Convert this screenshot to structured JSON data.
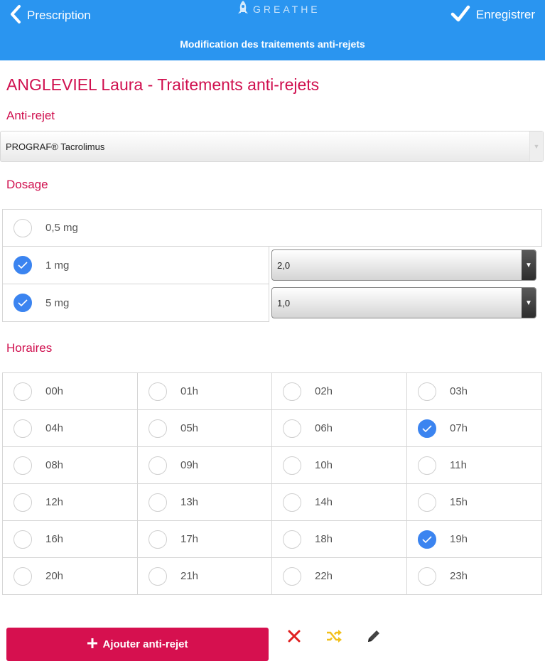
{
  "header": {
    "back_label": "Prescription",
    "logo_text": "GREATHE",
    "save_label": "Enregistrer",
    "subtitle": "Modification des traitements anti-rejets"
  },
  "page_title": "ANGLEVIEL Laura - Traitements anti-rejets",
  "antirejet": {
    "title": "Anti-rejet",
    "selected": "PROGRAF® Tacrolimus"
  },
  "dosage": {
    "title": "Dosage",
    "options": [
      {
        "label": "0,5 mg",
        "checked": false
      },
      {
        "label": "1 mg",
        "checked": true,
        "quantity": "2,0"
      },
      {
        "label": "5 mg",
        "checked": true,
        "quantity": "1,0"
      }
    ]
  },
  "horaires": {
    "title": "Horaires",
    "hours": [
      {
        "label": "00h",
        "checked": false
      },
      {
        "label": "01h",
        "checked": false
      },
      {
        "label": "02h",
        "checked": false
      },
      {
        "label": "03h",
        "checked": false
      },
      {
        "label": "04h",
        "checked": false
      },
      {
        "label": "05h",
        "checked": false
      },
      {
        "label": "06h",
        "checked": false
      },
      {
        "label": "07h",
        "checked": true
      },
      {
        "label": "08h",
        "checked": false
      },
      {
        "label": "09h",
        "checked": false
      },
      {
        "label": "10h",
        "checked": false
      },
      {
        "label": "11h",
        "checked": false
      },
      {
        "label": "12h",
        "checked": false
      },
      {
        "label": "13h",
        "checked": false
      },
      {
        "label": "14h",
        "checked": false
      },
      {
        "label": "15h",
        "checked": false
      },
      {
        "label": "16h",
        "checked": false
      },
      {
        "label": "17h",
        "checked": false
      },
      {
        "label": "18h",
        "checked": false
      },
      {
        "label": "19h",
        "checked": true
      },
      {
        "label": "20h",
        "checked": false
      },
      {
        "label": "21h",
        "checked": false
      },
      {
        "label": "22h",
        "checked": false
      },
      {
        "label": "23h",
        "checked": false
      }
    ]
  },
  "actions": {
    "add_label": "Ajouter anti-rejet",
    "delete_icon": "close-icon",
    "shuffle_icon": "shuffle-icon",
    "edit_icon": "pencil-icon"
  },
  "colors": {
    "header_blue": "#2a95f0",
    "accent_pink": "#d0104f",
    "check_blue": "#3b84f0",
    "delete_red": "#e02020",
    "shuffle_yellow": "#f2c01a"
  }
}
